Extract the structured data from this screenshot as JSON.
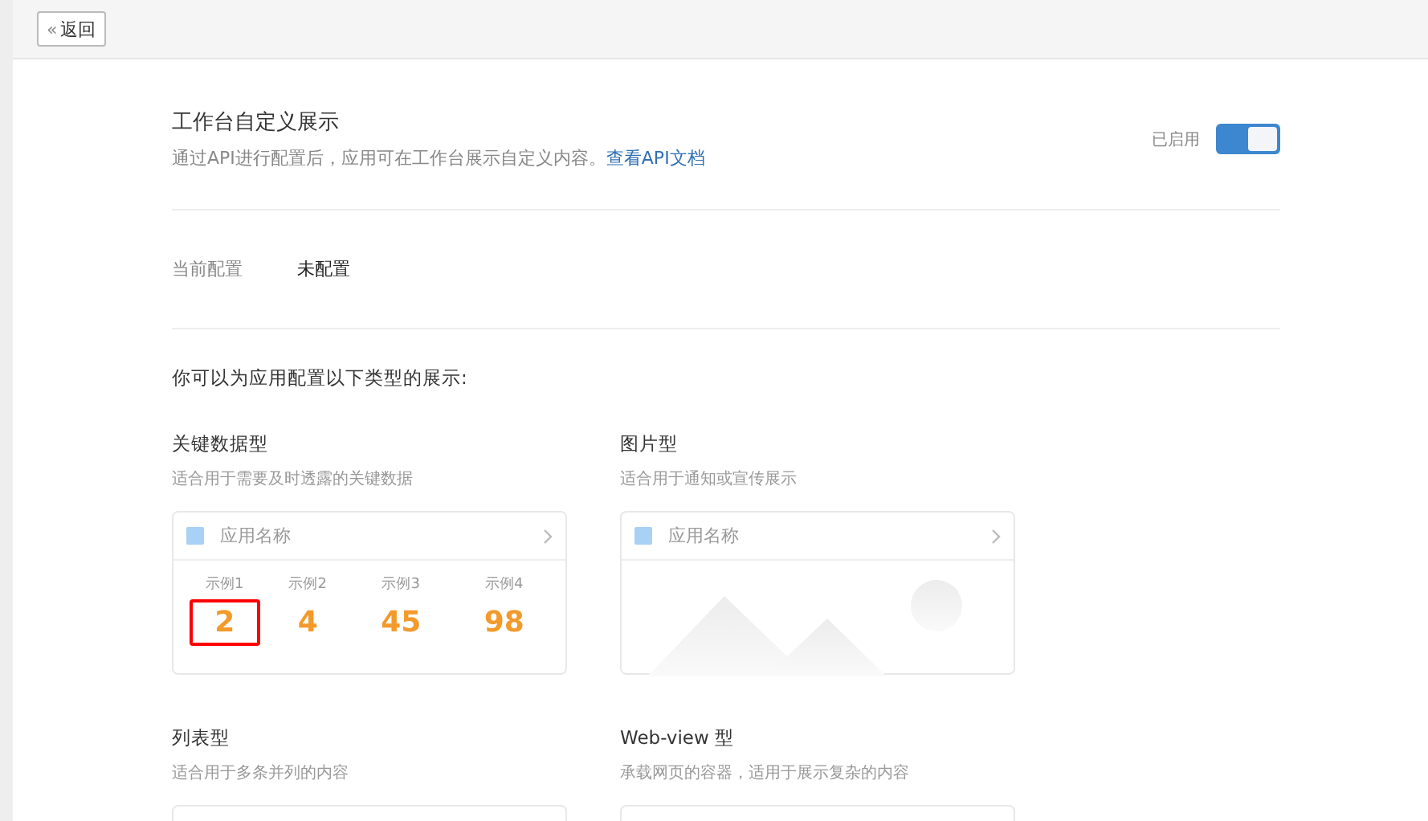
{
  "back_button": {
    "icon": "«",
    "label": "返回"
  },
  "header": {
    "title": "工作台自定义展示",
    "description": "通过API进行配置后，应用可在工作台展示自定义内容。",
    "link": "查看API文档",
    "toggle_label": "已启用",
    "toggle_on": true
  },
  "current_config": {
    "label": "当前配置",
    "value": "未配置"
  },
  "intro": "你可以为应用配置以下类型的展示:",
  "types": [
    {
      "kind": "metrics",
      "title": "关键数据型",
      "description": "适合用于需要及时透露的关键数据",
      "app_name": "应用名称",
      "metrics": [
        {
          "label": "示例1",
          "value": "2",
          "highlighted": true
        },
        {
          "label": "示例2",
          "value": "4",
          "highlighted": false
        },
        {
          "label": "示例3",
          "value": "45",
          "highlighted": false
        },
        {
          "label": "示例4",
          "value": "98",
          "highlighted": false
        }
      ]
    },
    {
      "kind": "picture",
      "title": "图片型",
      "description": "适合用于通知或宣传展示",
      "app_name": "应用名称"
    },
    {
      "kind": "list",
      "title": "列表型",
      "description": "适合用于多条并列的内容"
    },
    {
      "kind": "webview",
      "title": "Web-view 型",
      "description": "承载网页的容器，适用于展示复杂的内容"
    }
  ]
}
